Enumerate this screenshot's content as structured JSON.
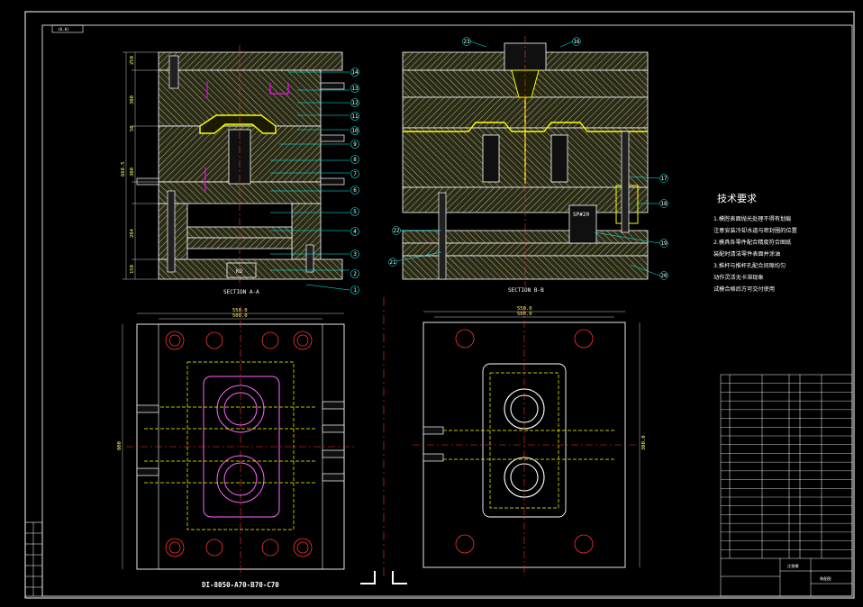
{
  "sheet": {
    "tag": "(0.0)",
    "section_a": "SECTION A-A",
    "section_b": "SECTION B-B",
    "ko_label": "KO",
    "plate_label": "SP#20",
    "bottom_caption": "DI-8050-A70-B70-C70"
  },
  "callouts_a": [
    "14",
    "13",
    "12",
    "11",
    "10",
    "9",
    "8",
    "7",
    "6",
    "5",
    "4",
    "3",
    "2",
    "1"
  ],
  "callouts_b_right": [
    "17",
    "18",
    "19",
    "20"
  ],
  "callouts_b_left": [
    "22",
    "21"
  ],
  "callouts_b_top": [
    "23",
    "16"
  ],
  "dims_a": [
    "250",
    "300",
    "50",
    "300",
    "284",
    "150",
    "250"
  ],
  "dims_a_total": "668.5",
  "plan_left_dims": [
    "550.0",
    "500.0"
  ],
  "plan_left_side": "800",
  "plan_right_dims": [
    "550.0",
    "500.0"
  ],
  "plan_right_side": "300.0",
  "tech_requirements": {
    "title": "技术要求",
    "lines": [
      "1.模腔表面抛光处理不得有划痕",
      "注意安装冷却水道与密封圈的位置",
      "2.模具各零件配合精度符合图纸",
      "装配时清洁零件表面并涂油",
      "3.推杆与推杆孔配合间隙均匀",
      "动作灵活无卡滞现象",
      "试模合格后方可交付使用"
    ]
  },
  "title_block": {
    "name": "注塑模",
    "sub": "装配图"
  }
}
